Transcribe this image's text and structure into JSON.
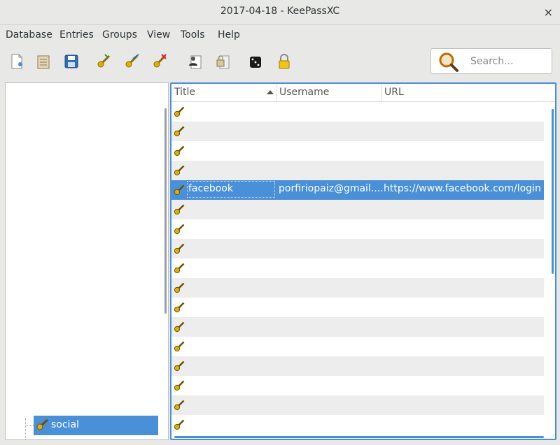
{
  "window": {
    "title": "2017-04-18 - KeePassXC",
    "close_glyph": "×"
  },
  "menu": [
    "Database",
    "Entries",
    "Groups",
    "View",
    "Tools",
    "Help"
  ],
  "toolbar": {
    "icons": [
      "new-database-icon",
      "open-database-icon",
      "save-database-icon",
      "add-entry-icon",
      "edit-entry-icon",
      "delete-entry-icon",
      "copy-username-icon",
      "copy-password-icon",
      "password-generator-icon",
      "lock-database-icon"
    ],
    "search_placeholder": "Search..."
  },
  "groups": {
    "selected": "social"
  },
  "entries": {
    "columns": [
      "Title",
      "Username",
      "URL"
    ],
    "sort_column": "Title",
    "rows": [
      {
        "title": "",
        "username": "",
        "url": ""
      },
      {
        "title": "",
        "username": "",
        "url": ""
      },
      {
        "title": "",
        "username": "",
        "url": ""
      },
      {
        "title": "",
        "username": "",
        "url": ""
      },
      {
        "title": "facebook",
        "username": "porfiriopaiz@gmail....",
        "url": "https://www.facebook.com/login"
      },
      {
        "title": "",
        "username": "",
        "url": ""
      },
      {
        "title": "",
        "username": "",
        "url": ""
      },
      {
        "title": "",
        "username": "",
        "url": ""
      },
      {
        "title": "",
        "username": "",
        "url": ""
      },
      {
        "title": "",
        "username": "",
        "url": ""
      },
      {
        "title": "",
        "username": "",
        "url": ""
      },
      {
        "title": "",
        "username": "",
        "url": ""
      },
      {
        "title": "",
        "username": "",
        "url": ""
      },
      {
        "title": "",
        "username": "",
        "url": ""
      },
      {
        "title": "",
        "username": "",
        "url": ""
      },
      {
        "title": "",
        "username": "",
        "url": ""
      },
      {
        "title": "",
        "username": "",
        "url": ""
      }
    ],
    "selected_index": 4
  },
  "colors": {
    "selection": "#4a90d9",
    "row_alt": "#ededed",
    "key_gold": "#e0b000"
  }
}
